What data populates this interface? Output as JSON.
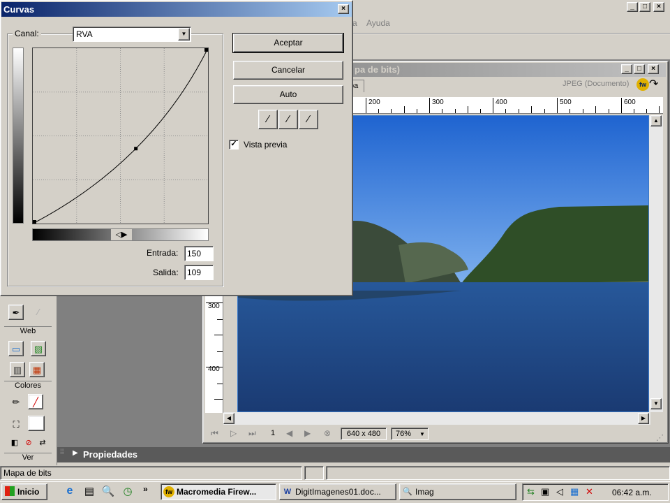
{
  "app": {
    "menu_partial": "a",
    "menu_help": "Ayuda",
    "doc_title": "pa de bits)",
    "doc_tab": "pa",
    "doc_format": "JPEG (Documento)",
    "ruler_h": [
      "200",
      "300",
      "400",
      "500",
      "600"
    ],
    "ruler_v": [
      "300",
      "400"
    ],
    "frame_number": "1",
    "image_size": "640 x 480",
    "zoom": "76%",
    "properties_label": "Propiedades",
    "status_text": "Mapa de bits",
    "main_win_buttons": [
      "_",
      "□",
      "×"
    ],
    "doc_win_buttons": [
      "_",
      "□",
      "×"
    ]
  },
  "tools": {
    "web_label": "Web",
    "colors_label": "Colores",
    "view_label": "Ver"
  },
  "dialog": {
    "title": "Curvas",
    "close": "×",
    "channel_label": "Canal:",
    "channel_value": "RVA",
    "ok": "Aceptar",
    "cancel": "Cancelar",
    "auto": "Auto",
    "preview_label": "Vista previa",
    "preview_checked": true,
    "input_label": "Entrada:",
    "input_value": "150",
    "output_label": "Salida:",
    "output_value": "109",
    "curve_point": {
      "input": 150,
      "output": 109
    },
    "check_mark": "✓",
    "dropdown_arrow": "▼"
  },
  "taskbar": {
    "start": "Inicio",
    "more": "»",
    "items": [
      "Macromedia Firew...",
      "DigitImagenes01.doc...",
      "Imag"
    ],
    "time": "06:42 a.m."
  },
  "colors": {
    "title_active": "#0a246a",
    "face": "#d4d0c8",
    "sky": "#2f7fe0",
    "water": "#1d3f78"
  }
}
